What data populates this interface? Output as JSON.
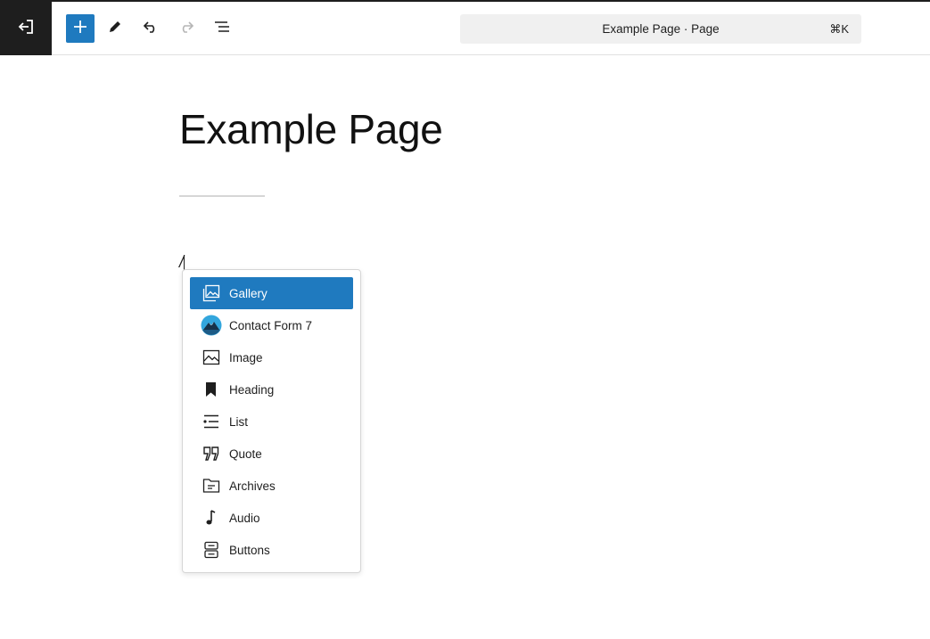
{
  "toolbar": {
    "back_icon": "exit-editor-icon",
    "add_icon": "plus-icon",
    "edit_icon": "pencil-icon",
    "undo_icon": "undo-icon",
    "redo_icon": "redo-icon",
    "outline_icon": "document-overview-icon",
    "accent_color": "#1f7abf"
  },
  "command_bar": {
    "title": "Example Page · Page",
    "shortcut": "⌘K"
  },
  "editor": {
    "page_title": "Example Page",
    "slash_text": "/"
  },
  "block_menu": {
    "items": [
      {
        "label": "Gallery",
        "icon": "gallery-icon",
        "selected": true
      },
      {
        "label": "Contact Form 7",
        "icon": "contact-form-7-icon",
        "selected": false
      },
      {
        "label": "Image",
        "icon": "image-icon",
        "selected": false
      },
      {
        "label": "Heading",
        "icon": "heading-bookmark-icon",
        "selected": false
      },
      {
        "label": "List",
        "icon": "list-icon",
        "selected": false
      },
      {
        "label": "Quote",
        "icon": "quote-icon",
        "selected": false
      },
      {
        "label": "Archives",
        "icon": "archives-folder-icon",
        "selected": false
      },
      {
        "label": "Audio",
        "icon": "audio-note-icon",
        "selected": false
      },
      {
        "label": "Buttons",
        "icon": "buttons-icon",
        "selected": false
      }
    ]
  }
}
